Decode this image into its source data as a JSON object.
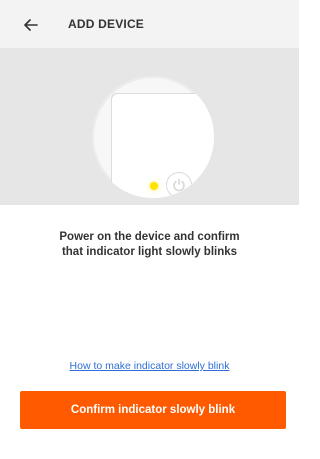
{
  "header": {
    "back_icon": "arrow-left-icon",
    "title": "ADD DEVICE"
  },
  "hero": {
    "indicator_color": "#ffe300",
    "power_icon": "power-icon"
  },
  "instruction": {
    "line1": "Power on the device and confirm",
    "line2": "that indicator light slowly blinks"
  },
  "help": {
    "link_label": "How to make indicator slowly blink"
  },
  "actions": {
    "confirm_label": "Confirm indicator slowly blink",
    "accent_color": "#ff5a00"
  }
}
